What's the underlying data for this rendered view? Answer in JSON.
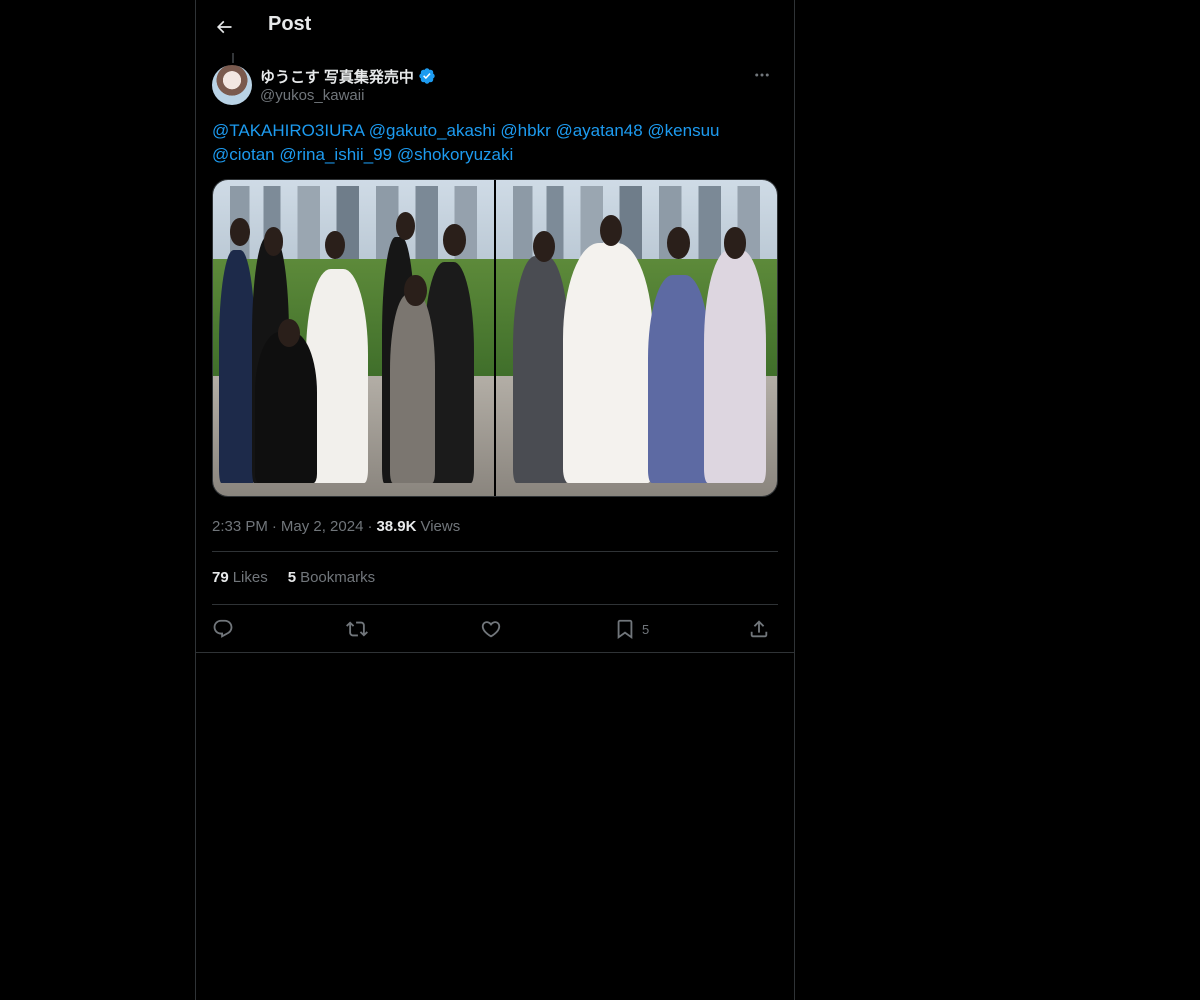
{
  "header": {
    "title": "Post"
  },
  "author": {
    "name": "ゆうこす 写真集発売中",
    "handle": "@yukos_kawaii",
    "verified": true
  },
  "tweet": {
    "mentions": [
      "@TAKAHIRO3IURA",
      "@gakuto_akashi",
      "@hbkr",
      "@ayatan48",
      "@kensuu",
      "@ciotan",
      "@rina_ishii_99",
      "@shokoryuzaki"
    ],
    "time": "2:33 PM",
    "date": "May 2, 2024",
    "views_count": "38.9K",
    "views_label": "Views",
    "separator": "·"
  },
  "stats": {
    "likes_count": "79",
    "likes_label": "Likes",
    "bookmarks_count": "5",
    "bookmarks_label": "Bookmarks"
  },
  "actions": {
    "bookmark_count": "5"
  },
  "colors": {
    "background": "#000000",
    "text": "#e7e9ea",
    "secondary": "#71767b",
    "link": "#1d9bf0",
    "border": "#2f3336"
  }
}
